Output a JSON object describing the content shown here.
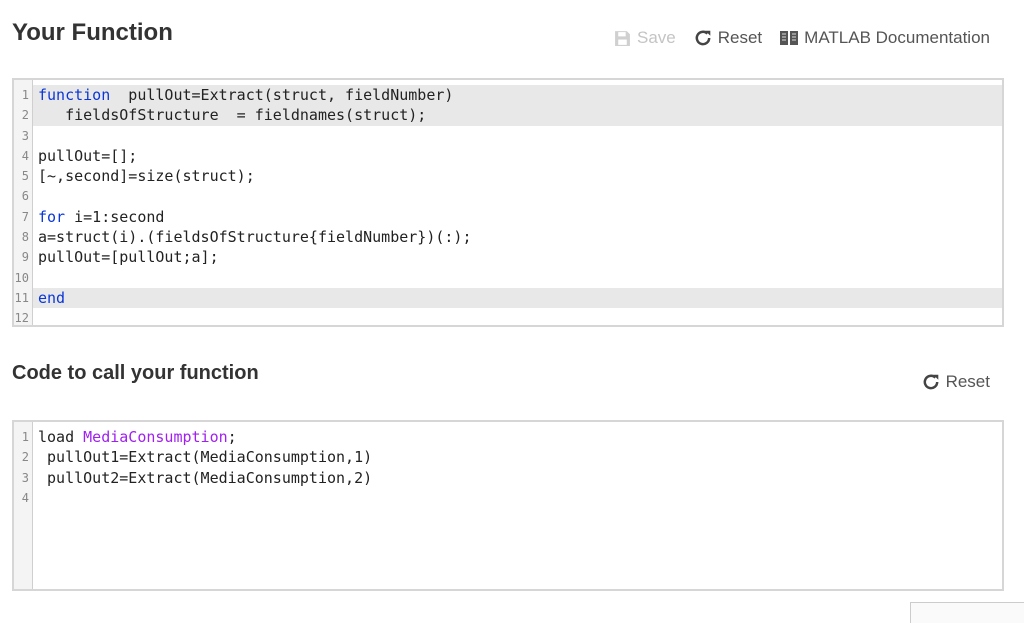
{
  "function_section": {
    "title": "Your Function",
    "toolbar": {
      "save_label": "Save",
      "save_enabled": false,
      "reset_label": "Reset",
      "docs_label": "MATLAB Documentation"
    },
    "editor": {
      "lines": [
        {
          "n": "1",
          "tokens": [
            {
              "t": "function",
              "c": "kw"
            },
            {
              "t": "  pullOut=Extract(struct, fieldNumber)"
            }
          ],
          "highlight": true
        },
        {
          "n": "2",
          "tokens": [
            {
              "t": "   fieldsOfStructure  = fieldnames(struct);"
            }
          ],
          "highlight": true
        },
        {
          "n": "3",
          "tokens": []
        },
        {
          "n": "4",
          "tokens": [
            {
              "t": "pullOut=[];"
            }
          ]
        },
        {
          "n": "5",
          "tokens": [
            {
              "t": "[~,second]=size(struct);"
            }
          ]
        },
        {
          "n": "6",
          "tokens": []
        },
        {
          "n": "7",
          "tokens": [
            {
              "t": "for",
              "c": "kw"
            },
            {
              "t": " i=1:second"
            }
          ]
        },
        {
          "n": "8",
          "tokens": [
            {
              "t": "a=struct(i).(fieldsOfStructure{fieldNumber})(:);"
            }
          ]
        },
        {
          "n": "9",
          "tokens": [
            {
              "t": "pullOut=[pullOut;a];"
            }
          ]
        },
        {
          "n": "10",
          "tokens": []
        },
        {
          "n": "11",
          "tokens": [
            {
              "t": "end",
              "c": "kw"
            }
          ],
          "highlight": true
        },
        {
          "n": "12",
          "tokens": []
        }
      ]
    }
  },
  "call_section": {
    "title": "Code to call your function",
    "toolbar": {
      "reset_label": "Reset"
    },
    "editor": {
      "lines": [
        {
          "n": "1",
          "tokens": [
            {
              "t": "load "
            },
            {
              "t": "MediaConsumption",
              "c": "str"
            },
            {
              "t": ";"
            }
          ]
        },
        {
          "n": "2",
          "tokens": [
            {
              "t": " pullOut1=Extract(MediaConsumption,1)"
            }
          ]
        },
        {
          "n": "3",
          "tokens": [
            {
              "t": " pullOut2=Extract(MediaConsumption,2)"
            }
          ]
        },
        {
          "n": "4",
          "tokens": []
        }
      ]
    }
  },
  "colors": {
    "keyword": "#0a36d8",
    "string": "#a020f0",
    "line_highlight": "#e8e8e8",
    "disabled": "#c4c4c4"
  }
}
